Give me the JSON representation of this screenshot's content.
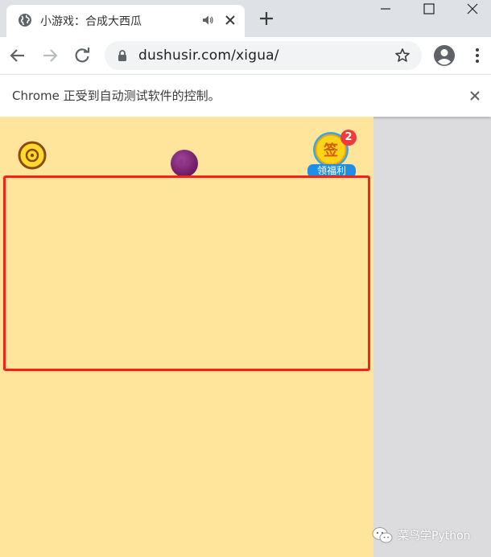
{
  "colors": {
    "tabstrip_bg": "#dee1e6",
    "game_bg": "#ffe49c",
    "highlight_border": "#f2231a",
    "fruit": "#7a1f6e",
    "welfare_label_bg": "#1e8fe6",
    "badge_bg": "#ee3b3b"
  },
  "tab": {
    "title": "小游戏：合成大西瓜",
    "favicon": "globe-icon",
    "audio_icon": "speaker-icon",
    "close_icon": "close-icon"
  },
  "window_controls": [
    "minimize-icon",
    "maximize-icon",
    "close-icon"
  ],
  "toolbar": {
    "url": "dushusir.com/xigua/",
    "icons": [
      "back-arrow-icon",
      "forward-arrow-icon",
      "reload-icon",
      "lock-icon",
      "star-icon",
      "profile-icon",
      "menu-dots-icon"
    ]
  },
  "infobar": {
    "message": "Chrome 正受到自动测试软件的控制。"
  },
  "game": {
    "welfare": {
      "char": "签",
      "badge_count": "2",
      "label": "领福利"
    }
  },
  "watermark": {
    "text": "菜鸟学Python"
  }
}
